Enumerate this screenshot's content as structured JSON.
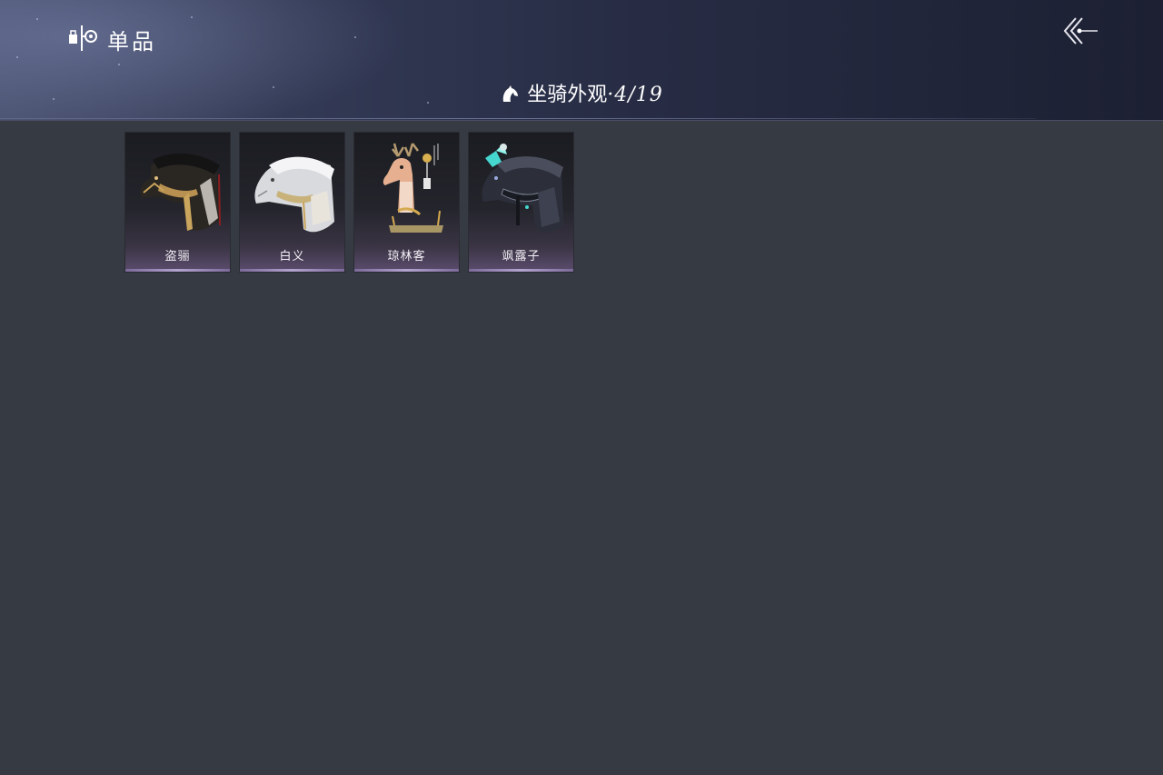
{
  "header": {
    "title": "单品",
    "back_icon": "chevron-back-icon",
    "title_icon": "shop-items-icon"
  },
  "section": {
    "icon": "horse-head-icon",
    "title": "坐骑外观",
    "count": "·4/19"
  },
  "items": [
    {
      "name": "盗骊",
      "art": "dark-armored-horse"
    },
    {
      "name": "白义",
      "art": "white-horse"
    },
    {
      "name": "琼林客",
      "art": "deer"
    },
    {
      "name": "飒露子",
      "art": "dark-horse-with-cyan-ornament"
    }
  ],
  "colors": {
    "background": "#363a43",
    "header_dark": "#1c2032",
    "card_accent": "#b3a3cf",
    "ornament_cyan": "#46d6d0"
  }
}
